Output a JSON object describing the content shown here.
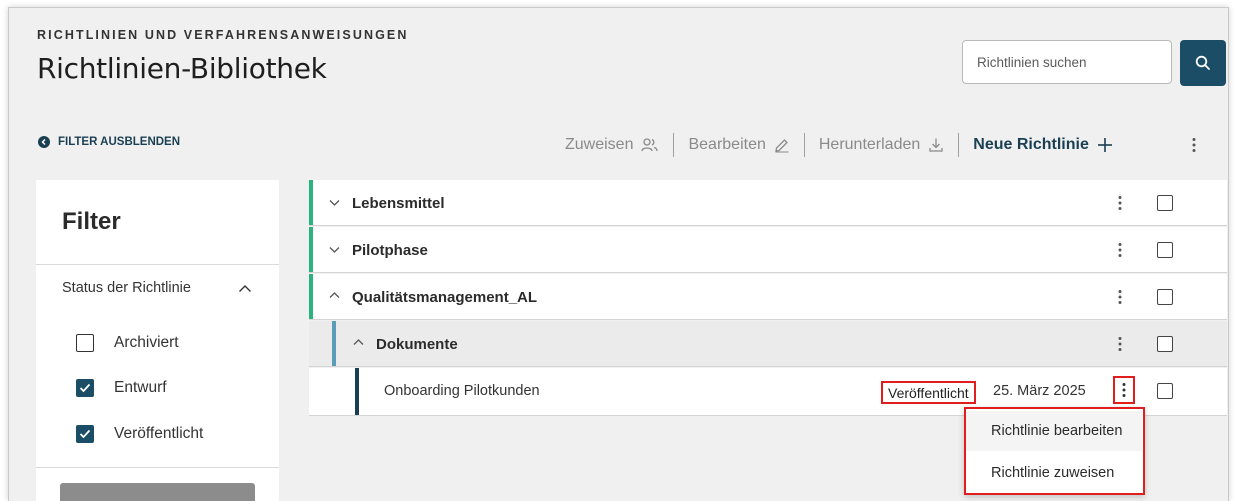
{
  "header": {
    "eyebrow": "RICHTLINIEN UND VERFAHRENSANWEISUNGEN",
    "title": "Richtlinien-Bibliothek"
  },
  "search": {
    "placeholder": "Richtlinien suchen",
    "button_icon": "search-icon"
  },
  "filter_toggle": {
    "label": "FILTER AUSBLENDEN",
    "icon": "chevron-left-circle-icon"
  },
  "toolbar": {
    "assign_label": "Zuweisen",
    "assign_icon": "people-icon",
    "edit_label": "Bearbeiten",
    "edit_icon": "pencil-icon",
    "download_label": "Herunterladen",
    "download_icon": "download-icon",
    "new_label": "Neue Richtlinie",
    "new_icon": "plus-icon",
    "more_icon": "kebab-icon"
  },
  "filter": {
    "title": "Filter",
    "status_heading": "Status der Richtlinie",
    "options": [
      {
        "label": "Archiviert",
        "checked": false
      },
      {
        "label": "Entwurf",
        "checked": true
      },
      {
        "label": "Veröffentlicht",
        "checked": true
      }
    ]
  },
  "tree": {
    "rows": [
      {
        "label": "Lebensmittel",
        "expanded": false,
        "accent": "#2bb37f"
      },
      {
        "label": "Pilotphase",
        "expanded": false,
        "accent": "#2bb37f"
      },
      {
        "label": "Qualitätsmanagement_AL",
        "expanded": true,
        "accent": "#2bb37f"
      },
      {
        "label": "Dokumente",
        "expanded": true,
        "accent": "#5b9cb8"
      }
    ],
    "document": {
      "label": "Onboarding Pilotkunden",
      "status": "Veröffentlicht",
      "date": "25. März 2025",
      "accent": "#1a3f52"
    }
  },
  "context_menu": {
    "items": [
      {
        "label": "Richtlinie bearbeiten"
      },
      {
        "label": "Richtlinie zuweisen"
      }
    ]
  },
  "colors": {
    "primary": "#1b4e66",
    "highlight": "#e01e1e",
    "background": "#f0f0f0"
  }
}
